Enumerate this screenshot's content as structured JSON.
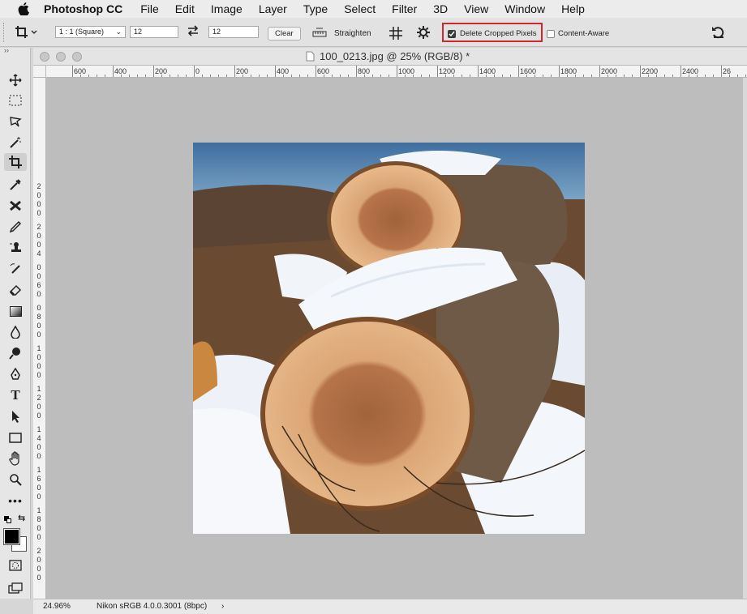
{
  "menubar": {
    "app_name": "Photoshop CC",
    "items": [
      "File",
      "Edit",
      "Image",
      "Layer",
      "Type",
      "Select",
      "Filter",
      "3D",
      "View",
      "Window",
      "Help"
    ]
  },
  "options": {
    "ratio_preset": "1 : 1 (Square)",
    "width_value": "12",
    "height_value": "12",
    "clear_label": "Clear",
    "straighten_label": "Straighten",
    "delete_cropped_label": "Delete Cropped Pixels",
    "delete_cropped_checked": true,
    "content_aware_label": "Content-Aware",
    "content_aware_checked": false,
    "highlight_color": "#d0262d"
  },
  "document": {
    "title": "100_0213.jpg @ 25% (RGB/8) *"
  },
  "rulers": {
    "top_labels": [
      "600",
      "400",
      "200",
      "0",
      "200",
      "400",
      "600",
      "800",
      "1000",
      "1200",
      "1400",
      "1600",
      "1800",
      "2000",
      "2200",
      "2400",
      "26"
    ],
    "left_labels": [
      "2",
      "0",
      "0",
      "0",
      "2",
      "0",
      "0",
      "4",
      "0",
      "0",
      "6",
      "0",
      "0",
      "8",
      "0",
      "0",
      "1",
      "0",
      "0",
      "0",
      "1",
      "2",
      "0",
      "0",
      "1",
      "4",
      "0",
      "0",
      "1",
      "6",
      "0",
      "0",
      "1",
      "8",
      "0",
      "0",
      "2",
      "0",
      "0",
      "0"
    ]
  },
  "tools": [
    "move-tool-icon",
    "marquee-tool-icon",
    "lasso-tool-icon",
    "magic-wand-icon",
    "crop-tool-icon",
    "eyedropper-icon",
    "healing-brush-icon",
    "brush-tool-icon",
    "clone-stamp-icon",
    "history-brush-icon",
    "eraser-icon",
    "gradient-icon",
    "blur-tool-icon",
    "dodge-tool-icon",
    "pen-tool-icon",
    "type-tool-icon",
    "path-selection-icon",
    "rectangle-tool-icon",
    "hand-tool-icon",
    "zoom-tool-icon",
    "more-tools-icon"
  ],
  "status": {
    "zoom": "24.96%",
    "profile": "Nikon sRGB 4.0.0.3001 (8bpc)",
    "arrow": "›"
  },
  "colors": {
    "canvas_bg": "#bdbdbd",
    "foreground": "#000000",
    "background": "#ffffff"
  }
}
